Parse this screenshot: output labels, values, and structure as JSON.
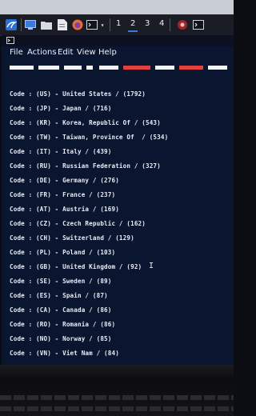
{
  "taskbar": {
    "workspaces": [
      "1",
      "2",
      "3",
      "4"
    ],
    "active_workspace": "2",
    "icons": [
      "kali-menu-icon",
      "desktop-icon",
      "file-manager-icon",
      "text-editor-icon",
      "firefox-icon",
      "terminal-icon",
      "dropdown-chevron-icon",
      "app-icon-red",
      "terminal-window-icon"
    ]
  },
  "terminal": {
    "menu": [
      "File",
      "Actions",
      "Edit",
      "View",
      "Help"
    ],
    "lines": [
      "Code : (US) - United States / (1792)",
      "Code : (JP) - Japan / (716)",
      "Code : (KR) - Korea, Republic Of / (543)",
      "Code : (TW) - Taiwan, Province Of  / (534)",
      "Code : (IT) - Italy / (439)",
      "Code : (RU) - Russian Federation / (327)",
      "Code : (DE) - Germany / (276)",
      "Code : (FR) - France / (237)",
      "Code : (AT) - Austria / (169)",
      "Code : (CZ) - Czech Republic / (162)",
      "Code : (CH) - Switzerland / (129)",
      "Code : (PL) - Poland / (103)",
      "Code : (GB) - United Kingdom / (92)",
      "Code : (SE) - Sweden / (89)",
      "Code : (ES) - Spain / (87)",
      "Code : (CA) - Canada / (86)",
      "Code : (RO) - Romania / (86)",
      "Code : (NO) - Norway / (85)",
      "Code : (VN) - Viet Nam / (84)"
    ]
  },
  "colors": {
    "terminal_bg": "#0a1530",
    "text": "#e9edf6",
    "accent": "#3a7bdc",
    "banner_red": "#e04040"
  }
}
